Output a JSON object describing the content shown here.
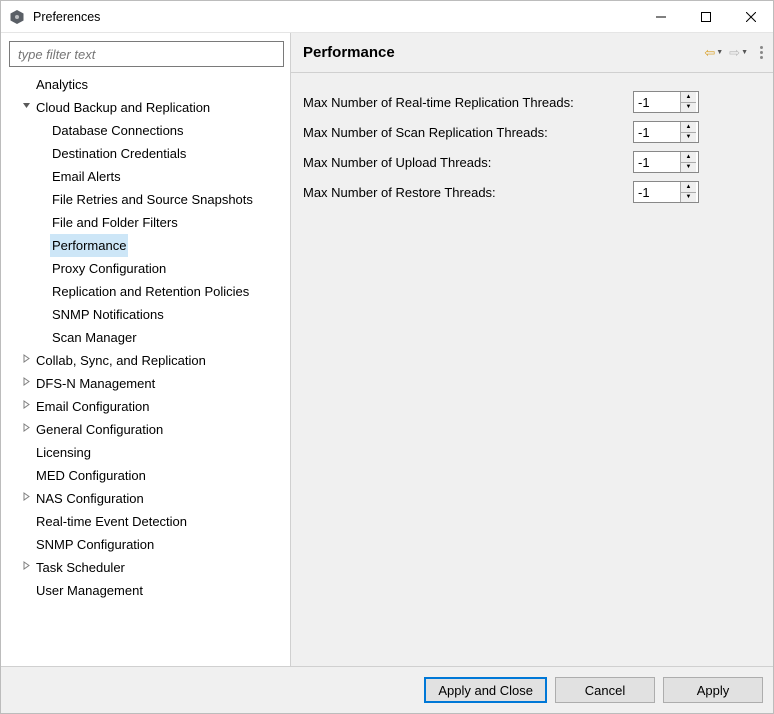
{
  "window": {
    "title": "Preferences"
  },
  "filter": {
    "placeholder": "type filter text"
  },
  "tree": [
    {
      "label": "Analytics",
      "level": 1,
      "chev": ""
    },
    {
      "label": "Cloud Backup and Replication",
      "level": 1,
      "chev": "v"
    },
    {
      "label": "Database Connections",
      "level": 2,
      "chev": ""
    },
    {
      "label": "Destination Credentials",
      "level": 2,
      "chev": ""
    },
    {
      "label": "Email Alerts",
      "level": 2,
      "chev": ""
    },
    {
      "label": "File Retries and Source Snapshots",
      "level": 2,
      "chev": ""
    },
    {
      "label": "File and Folder Filters",
      "level": 2,
      "chev": ""
    },
    {
      "label": "Performance",
      "level": 2,
      "chev": "",
      "selected": true
    },
    {
      "label": "Proxy Configuration",
      "level": 2,
      "chev": ""
    },
    {
      "label": "Replication and Retention Policies",
      "level": 2,
      "chev": ""
    },
    {
      "label": "SNMP Notifications",
      "level": 2,
      "chev": ""
    },
    {
      "label": "Scan Manager",
      "level": 2,
      "chev": ""
    },
    {
      "label": "Collab, Sync, and Replication",
      "level": 1,
      "chev": ">"
    },
    {
      "label": "DFS-N Management",
      "level": 1,
      "chev": ">"
    },
    {
      "label": "Email Configuration",
      "level": 1,
      "chev": ">"
    },
    {
      "label": "General Configuration",
      "level": 1,
      "chev": ">"
    },
    {
      "label": "Licensing",
      "level": 1,
      "chev": ""
    },
    {
      "label": "MED Configuration",
      "level": 1,
      "chev": ""
    },
    {
      "label": "NAS Configuration",
      "level": 1,
      "chev": ">"
    },
    {
      "label": "Real-time Event Detection",
      "level": 1,
      "chev": ""
    },
    {
      "label": "SNMP Configuration",
      "level": 1,
      "chev": ""
    },
    {
      "label": "Task Scheduler",
      "level": 1,
      "chev": ">"
    },
    {
      "label": "User Management",
      "level": 1,
      "chev": ""
    }
  ],
  "content": {
    "title": "Performance",
    "fields": [
      {
        "label": "Max Number of Real-time Replication Threads:",
        "value": "-1"
      },
      {
        "label": "Max Number of Scan Replication Threads:",
        "value": "-1"
      },
      {
        "label": "Max Number of Upload Threads:",
        "value": "-1"
      },
      {
        "label": "Max Number of Restore Threads:",
        "value": "-1"
      }
    ]
  },
  "footer": {
    "applyClose": "Apply and Close",
    "cancel": "Cancel",
    "apply": "Apply"
  }
}
